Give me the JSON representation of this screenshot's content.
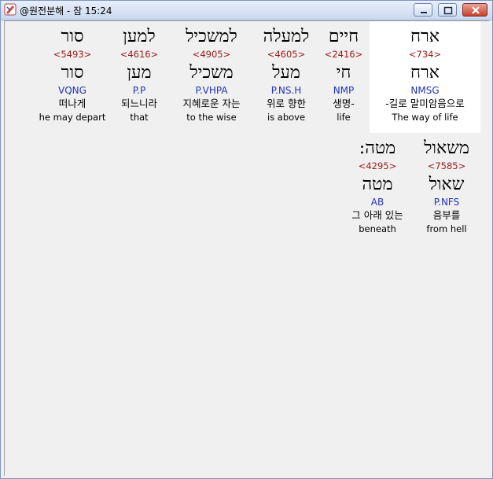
{
  "window": {
    "title": "@원전분해 - 잠 15:24"
  },
  "rows": [
    {
      "words": [
        {
          "hebrew": "ארח",
          "strong": "<734>",
          "lemma": "ארח",
          "morph": "NMSG",
          "korean": "-길로 말미암음으로",
          "english": "The way of life",
          "highlight": true
        },
        {
          "hebrew": "חיים",
          "strong": "<2416>",
          "lemma": "חי",
          "morph": "NMP",
          "korean": "생명-",
          "english": "life",
          "highlight": false
        },
        {
          "hebrew": "למעלה",
          "strong": "<4605>",
          "lemma": "מעל",
          "morph": "P.NS.H",
          "korean": "위로 향한",
          "english": "is above",
          "highlight": false
        },
        {
          "hebrew": "למשכיל",
          "strong": "<4905>",
          "lemma": "משכיל",
          "morph": "P.VHPA",
          "korean": "지혜로운 자는",
          "english": "to the wise",
          "highlight": false
        },
        {
          "hebrew": "למען",
          "strong": "<4616>",
          "lemma": "מען",
          "morph": "P.P",
          "korean": "되느니라",
          "english": "that",
          "highlight": false
        },
        {
          "hebrew": "סור",
          "strong": "<5493>",
          "lemma": "סור",
          "morph": "VQNG",
          "korean": "떠나게",
          "english": "he may depart",
          "highlight": false
        }
      ]
    },
    {
      "words": [
        {
          "hebrew": "משאול",
          "strong": "<7585>",
          "lemma": "שאול",
          "morph": "P.NFS",
          "korean": "음부를",
          "english": "from hell",
          "highlight": false
        },
        {
          "hebrew": "מטה:",
          "strong": "<4295>",
          "lemma": "מטה",
          "morph": "AB",
          "korean": "그 아래 있는",
          "english": "beneath",
          "highlight": false
        }
      ]
    }
  ]
}
